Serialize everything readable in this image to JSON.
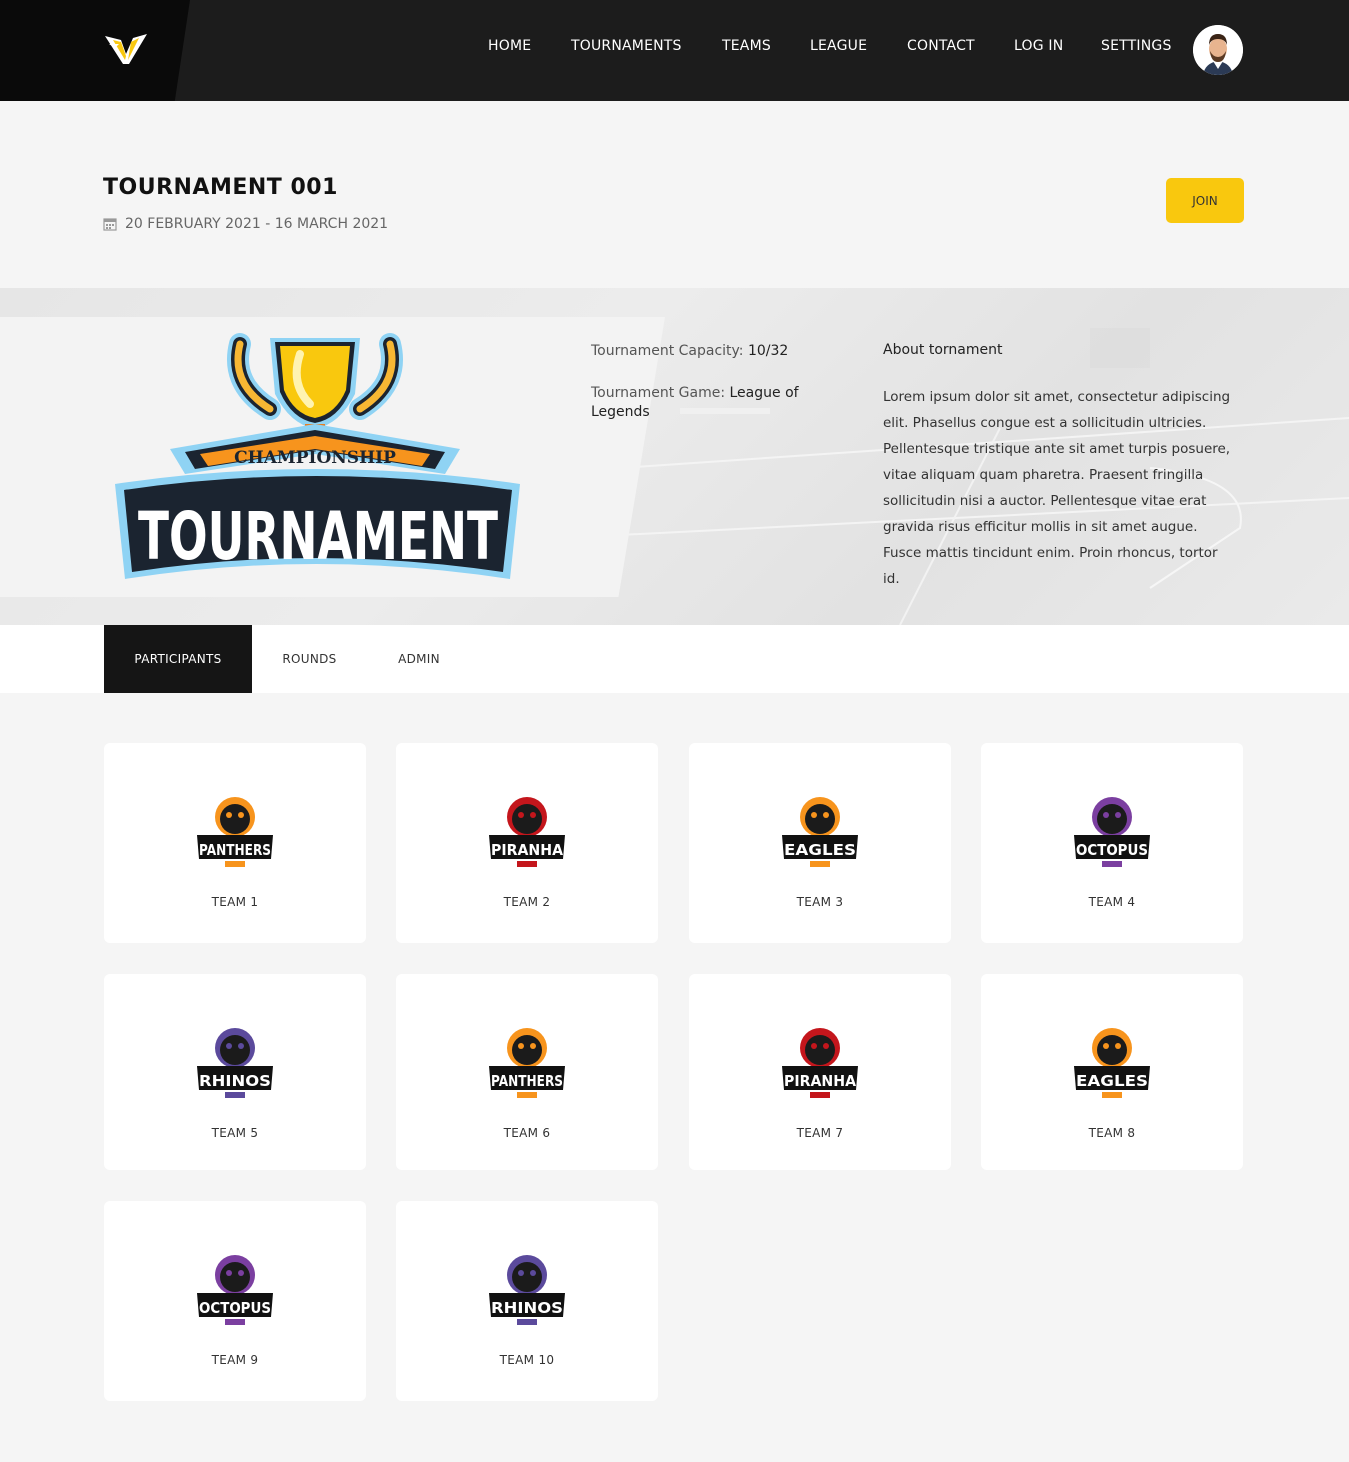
{
  "nav": {
    "logo": "v-logo-icon",
    "links": [
      "HOME",
      "TOURNAMENTS",
      "TEAMS",
      "LEAGUE",
      "CONTACT",
      "LOG IN",
      "SETTINGS"
    ],
    "avatar": "user-avatar"
  },
  "header": {
    "title": "TOURNAMENT 001",
    "dates": "20 FEBRUARY 2021 - 16 MARCH 2021",
    "join_label": "JOIN"
  },
  "hero": {
    "logo_top": "CHAMPIONSHIP",
    "logo_main": "TOURNAMENT",
    "capacity_label": "Tournament Capacity:",
    "capacity_value": "10/32",
    "game_label": "Tournament Game:",
    "game_value": "League of Legends",
    "about_title": "About tornament",
    "about_text": "Lorem ipsum dolor sit amet, consectetur adipiscing elit. Phasellus congue est a sollicitudin ultricies. Pellentesque tristique ante sit amet turpis posuere, vitae aliquam quam pharetra. Praesent fringilla sollicitudin nisi a auctor. Pellentesque vitae erat gravida risus efficitur mollis in sit amet augue. Fusce mattis tincidunt enim. Proin rhoncus, tortor id."
  },
  "tabs": [
    "PARTICIPANTS",
    "ROUNDS",
    "ADMIN"
  ],
  "teams": [
    {
      "name": "TEAM 1",
      "crest": "PANTHERS",
      "color": "#f7941d"
    },
    {
      "name": "TEAM 2",
      "crest": "PIRANHA",
      "color": "#c4161c"
    },
    {
      "name": "TEAM 3",
      "crest": "EAGLES",
      "color": "#f7941d"
    },
    {
      "name": "TEAM 4",
      "crest": "OCTOPUS",
      "color": "#7b3fa0"
    },
    {
      "name": "TEAM 5",
      "crest": "RHINOS",
      "color": "#5b4a9c"
    },
    {
      "name": "TEAM 6",
      "crest": "PANTHERS",
      "color": "#f7941d"
    },
    {
      "name": "TEAM 7",
      "crest": "PIRANHA",
      "color": "#c4161c"
    },
    {
      "name": "TEAM 8",
      "crest": "EAGLES",
      "color": "#f7941d"
    },
    {
      "name": "TEAM 9",
      "crest": "OCTOPUS",
      "color": "#7b3fa0"
    },
    {
      "name": "TEAM 10",
      "crest": "RHINOS",
      "color": "#5b4a9c"
    }
  ],
  "colors": {
    "accent": "#f9c80e",
    "nav_bg": "#1c1c1c"
  }
}
